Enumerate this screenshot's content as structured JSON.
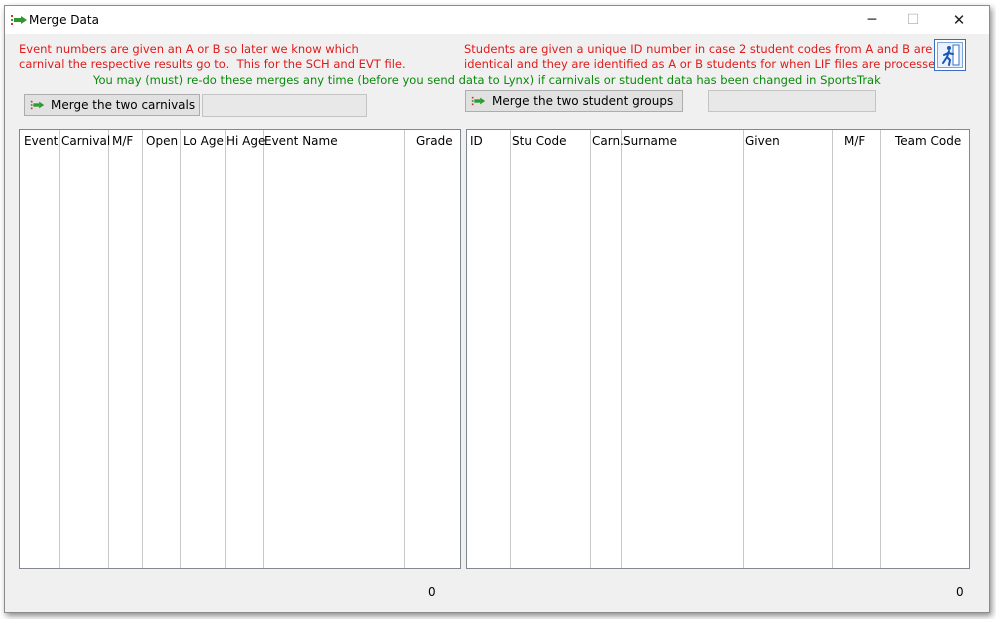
{
  "window": {
    "title": "Merge Data",
    "icon": "merge-arrow-icon",
    "controls": {
      "minimize": "─",
      "maximize": "☐",
      "close": "✕"
    }
  },
  "notes": {
    "carnivals": "Event numbers are given an A or B so later we know which\ncarnival the respective results go to.  This for the SCH and EVT file.",
    "students": "Students are given a unique ID number in case 2 student codes from A and B are\nidentical and they are identified as A or B students for when LIF files are processed",
    "redo": "You may (must) re-do these merges any time (before you send data to Lynx) if carnivals or student data has been changed in SportsTrak"
  },
  "carnivals": {
    "button_label": "Merge the two carnivals",
    "status_value": "",
    "columns": [
      "Event",
      "Carnival",
      "M/F",
      "Open",
      "Lo Age",
      "Hi Age",
      "Event Name",
      "Grade"
    ],
    "row_count": "0"
  },
  "students": {
    "button_label": "Merge the two student groups",
    "status_value": "",
    "columns": [
      "ID",
      "Stu Code",
      "Carn.",
      "Surname",
      "Given",
      "M/F",
      "Team Code"
    ],
    "row_count": "0"
  },
  "run_button_icon": "running-man-exit-icon",
  "colors": {
    "note_red": "#e01b1b",
    "note_green": "#0a8a0a",
    "icon_green": "#2e9a2e",
    "icon_red": "#d03030"
  }
}
